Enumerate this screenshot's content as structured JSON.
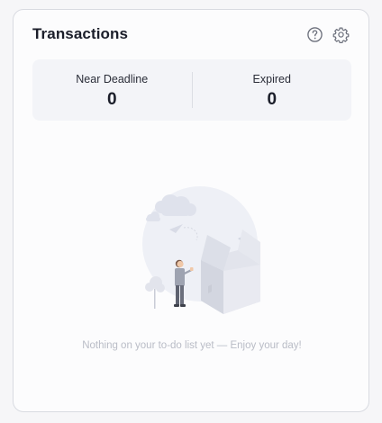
{
  "widget": {
    "title": "Transactions",
    "icons": {
      "help": "help-circle-icon",
      "settings": "gear-icon"
    }
  },
  "stats": [
    {
      "label": "Near Deadline",
      "value": "0"
    },
    {
      "label": "Expired",
      "value": "0"
    }
  ],
  "empty_state": {
    "message": "Nothing on your to-do list yet — Enjoy your day!",
    "illustration": "person-with-open-box-illustration"
  },
  "colors": {
    "title": "#1b1e2a",
    "muted_text": "#b9bcc6",
    "stats_background": "#f3f4f8",
    "card_border": "#d9dbe1"
  }
}
